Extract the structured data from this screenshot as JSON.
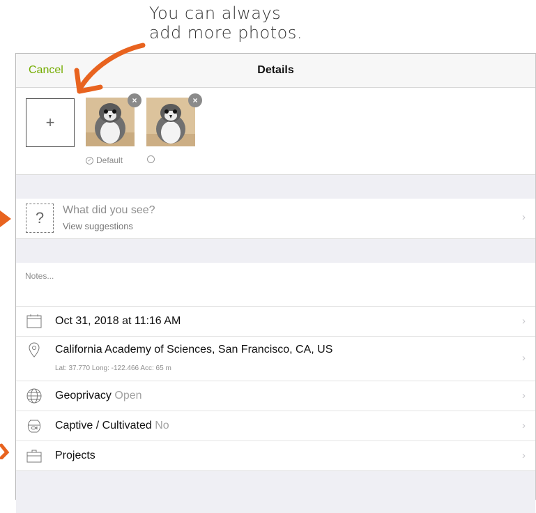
{
  "annotation": {
    "line1": "You can always",
    "line2": "add more photos."
  },
  "navbar": {
    "cancel": "Cancel",
    "title": "Details"
  },
  "photos": {
    "default_label": "Default",
    "remove_glyph": "×",
    "add_glyph": "+"
  },
  "species": {
    "icon_glyph": "?",
    "title": "What did you see?",
    "subtitle": "View suggestions"
  },
  "notes": {
    "placeholder": "Notes..."
  },
  "rows": {
    "date": {
      "icon": "calendar-icon",
      "label": "Oct 31, 2018 at 11:16 AM"
    },
    "location": {
      "icon": "location-pin-icon",
      "label": "California Academy of Sciences, San Francisco, CA, US",
      "coords": "Lat: 37.770  Long: -122.466  Acc: 65 m"
    },
    "geoprivacy": {
      "icon": "globe-icon",
      "label": "Geoprivacy",
      "value": "Open"
    },
    "captive": {
      "icon": "fishbowl-icon",
      "label": "Captive / Cultivated",
      "value": "No"
    },
    "projects": {
      "icon": "briefcase-icon",
      "label": "Projects"
    }
  },
  "chevron": "›",
  "colors": {
    "accent": "#74ac00",
    "annotation_arrow": "#e8631f"
  }
}
